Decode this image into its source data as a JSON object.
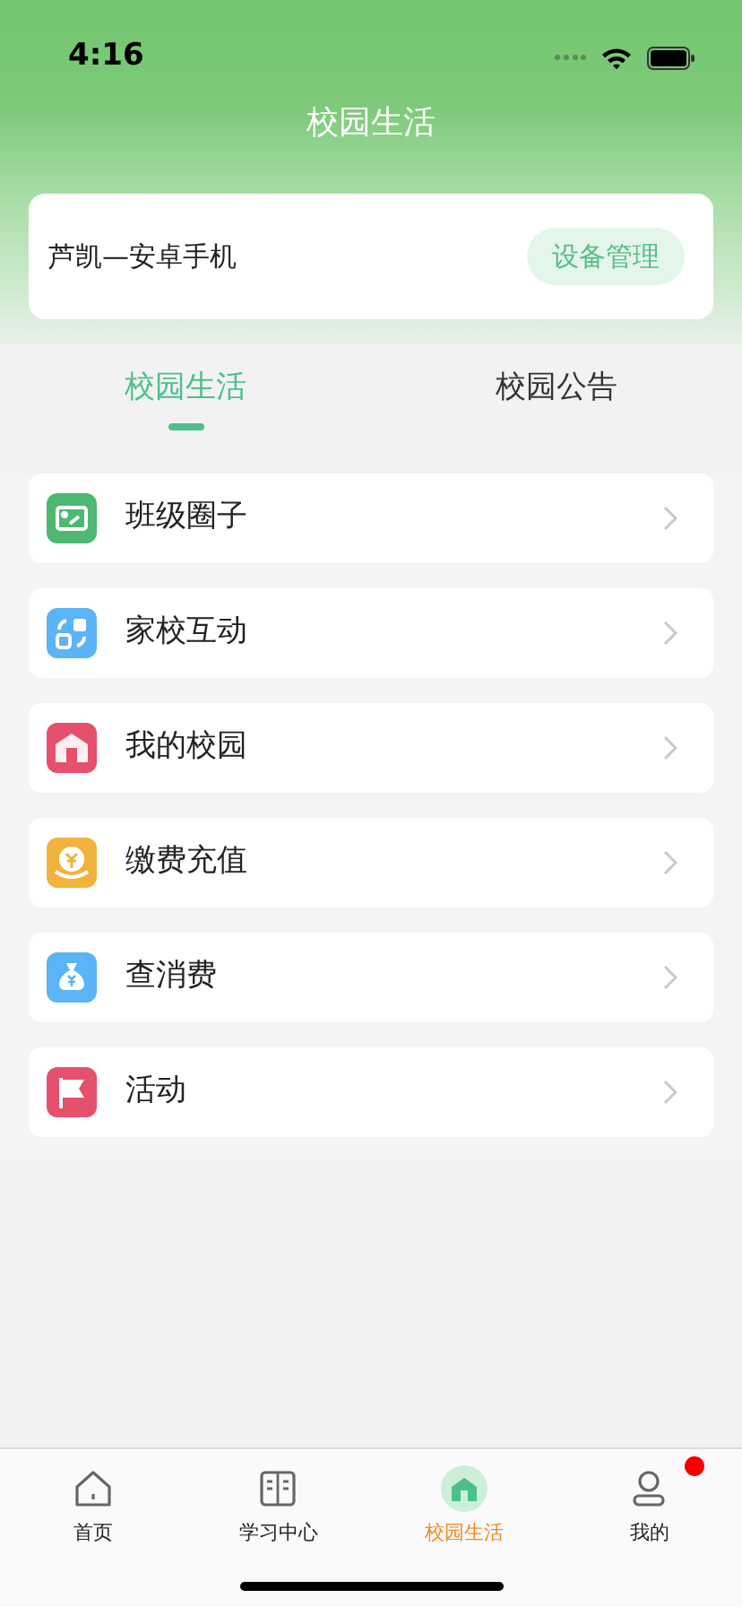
{
  "status_bar": {
    "time": "4:16"
  },
  "header": {
    "title": "校园生活"
  },
  "device_card": {
    "name": "芦凯—安卓手机",
    "button": "设备管理"
  },
  "tabs": [
    {
      "label": "校园生活",
      "selected": true
    },
    {
      "label": "校园公告",
      "selected": false
    }
  ],
  "menu_items": [
    {
      "label": "班级圈子",
      "color": "#4db872"
    },
    {
      "label": "家校互动",
      "color": "#5ab4f5"
    },
    {
      "label": "我的校园",
      "color": "#e5506d"
    },
    {
      "label": "缴费充值",
      "color": "#f0b43c"
    },
    {
      "label": "查消费",
      "color": "#5ab4f5"
    },
    {
      "label": "活动",
      "color": "#e5506d"
    }
  ],
  "tab_bar": [
    {
      "label": "首页",
      "selected": false,
      "badge": false
    },
    {
      "label": "学习中心",
      "selected": false,
      "badge": false
    },
    {
      "label": "校园生活",
      "selected": true,
      "badge": false
    },
    {
      "label": "我的",
      "selected": false,
      "badge": true
    }
  ]
}
